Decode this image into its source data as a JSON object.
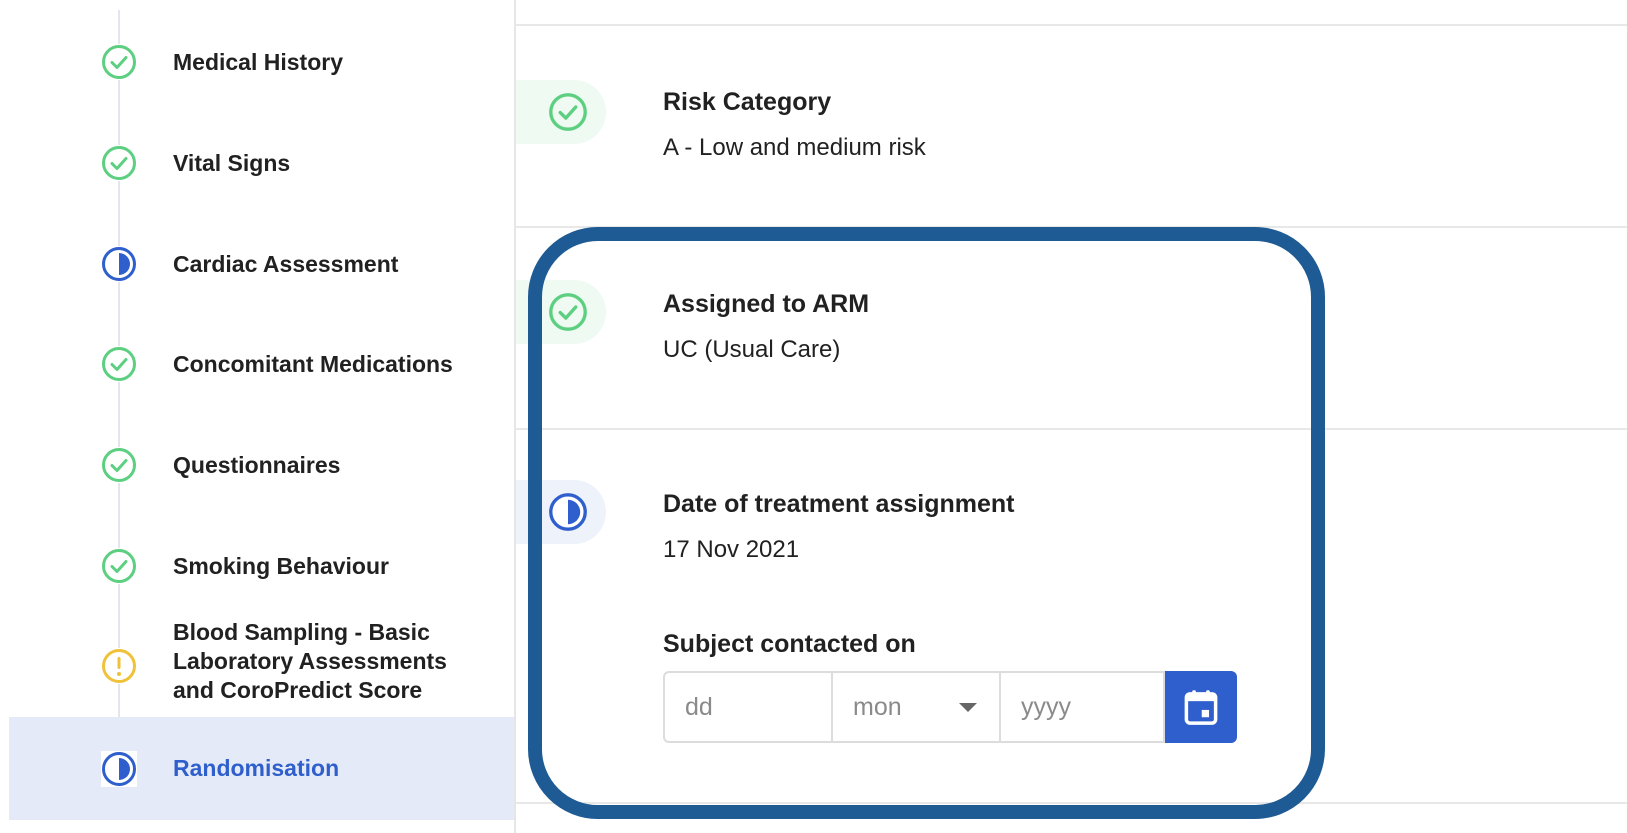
{
  "sidebar": {
    "items": [
      {
        "label": "Medical History",
        "status": "complete"
      },
      {
        "label": "Vital Signs",
        "status": "complete"
      },
      {
        "label": "Cardiac Assessment",
        "status": "in-progress"
      },
      {
        "label": "Concomitant Medications",
        "status": "complete"
      },
      {
        "label": "Questionnaires",
        "status": "complete"
      },
      {
        "label": "Smoking Behaviour",
        "status": "complete"
      },
      {
        "label_lines": [
          "Blood Sampling - Basic",
          "Laboratory Assessments",
          "and CoroPredict Score"
        ],
        "status": "warning"
      },
      {
        "label": "Randomisation",
        "status": "in-progress",
        "active": true
      }
    ]
  },
  "main": {
    "fields": [
      {
        "title": "Risk Category",
        "value": "A - Low and medium risk",
        "status": "complete"
      },
      {
        "title": "Assigned to ARM",
        "value": "UC (Usual Care)",
        "status": "complete"
      },
      {
        "title": "Date of treatment assignment",
        "value": "17 Nov 2021",
        "status": "in-progress"
      }
    ],
    "contact_date": {
      "label": "Subject contacted on",
      "day_placeholder": "dd",
      "month_value": "mon",
      "year_placeholder": "yyyy"
    }
  },
  "colors": {
    "complete": "#5ccf80",
    "in_progress": "#2f5fcc",
    "warning": "#f0c23a",
    "active_bg": "#e4eaf7",
    "highlight_frame": "#1e5a93"
  },
  "icons": {
    "complete": "check-circle-icon",
    "in_progress": "half-circle-icon",
    "warning": "exclamation-circle-icon",
    "calendar": "calendar-icon",
    "dropdown": "caret-down-icon"
  }
}
